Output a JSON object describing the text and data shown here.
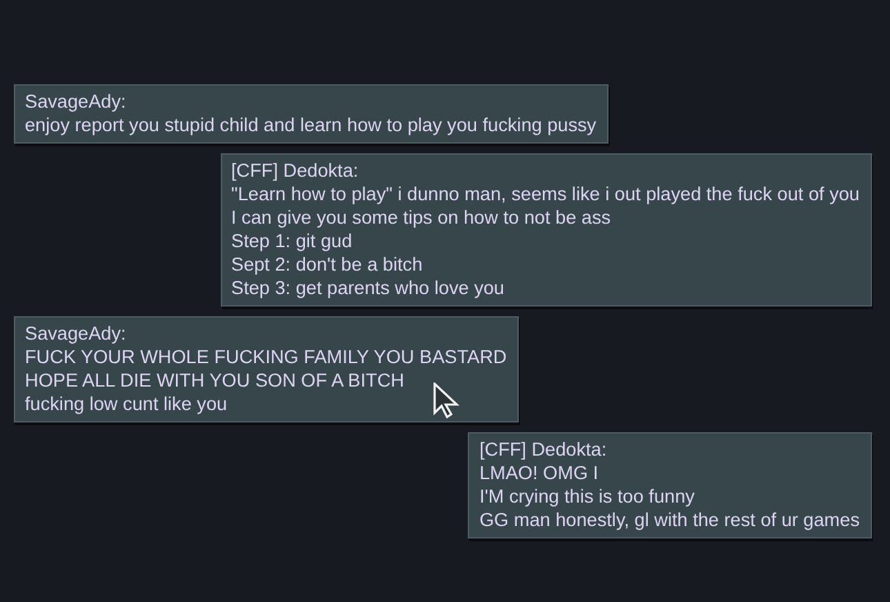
{
  "messages": [
    {
      "kind": "incoming",
      "sender": "SavageAdy:",
      "lines": [
        "enjoy report you stupid child and learn how to play you fucking pussy"
      ]
    },
    {
      "kind": "outgoing",
      "sender": "[CFF] Dedokta:",
      "lines": [
        "\"Learn how to play\" i dunno man, seems like i out played the fuck out of you",
        "I can give you some tips on how to not be ass",
        "Step 1: git gud",
        "Sept 2: don't be a bitch",
        "Step 3: get parents who love you"
      ]
    },
    {
      "kind": "incoming",
      "sender": "SavageAdy:",
      "lines": [
        "FUCK YOUR WHOLE FUCKING FAMILY YOU BASTARD",
        "HOPE ALL DIE WITH YOU SON OF A BITCH",
        "fucking low cunt like you"
      ]
    },
    {
      "kind": "outgoing",
      "sender": "[CFF] Dedokta:",
      "lines": [
        "LMAO! OMG I",
        "I'M crying this is too funny",
        "GG man honestly, gl with the rest of ur games"
      ]
    }
  ]
}
